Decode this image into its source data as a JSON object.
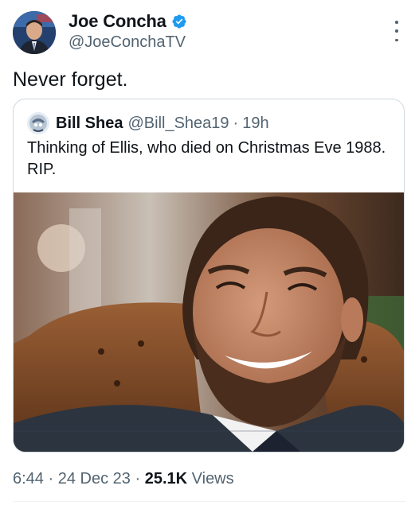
{
  "author": {
    "display_name": "Joe Concha",
    "handle": "@JoeConchaTV",
    "verified": true,
    "verified_color": "#1d9bf0"
  },
  "tweet": {
    "text": "Never forget."
  },
  "quoted_tweet": {
    "display_name": "Bill Shea",
    "handle": "@Bill_Shea19",
    "separator": "·",
    "time": "19h",
    "text": "Thinking of Ellis, who died on Christmas Eve 1988. RIP.",
    "image_icon": "photo-smiling-man"
  },
  "meta": {
    "time": "6:44",
    "separator": "·",
    "date": "24 Dec 23",
    "views_count": "25.1K",
    "views_label": "Views"
  },
  "icons": {
    "more": "more-options-icon",
    "verified": "verified-badge-icon"
  },
  "colors": {
    "text_primary": "#0f1419",
    "text_secondary": "#536471",
    "border": "#cfd9de"
  }
}
